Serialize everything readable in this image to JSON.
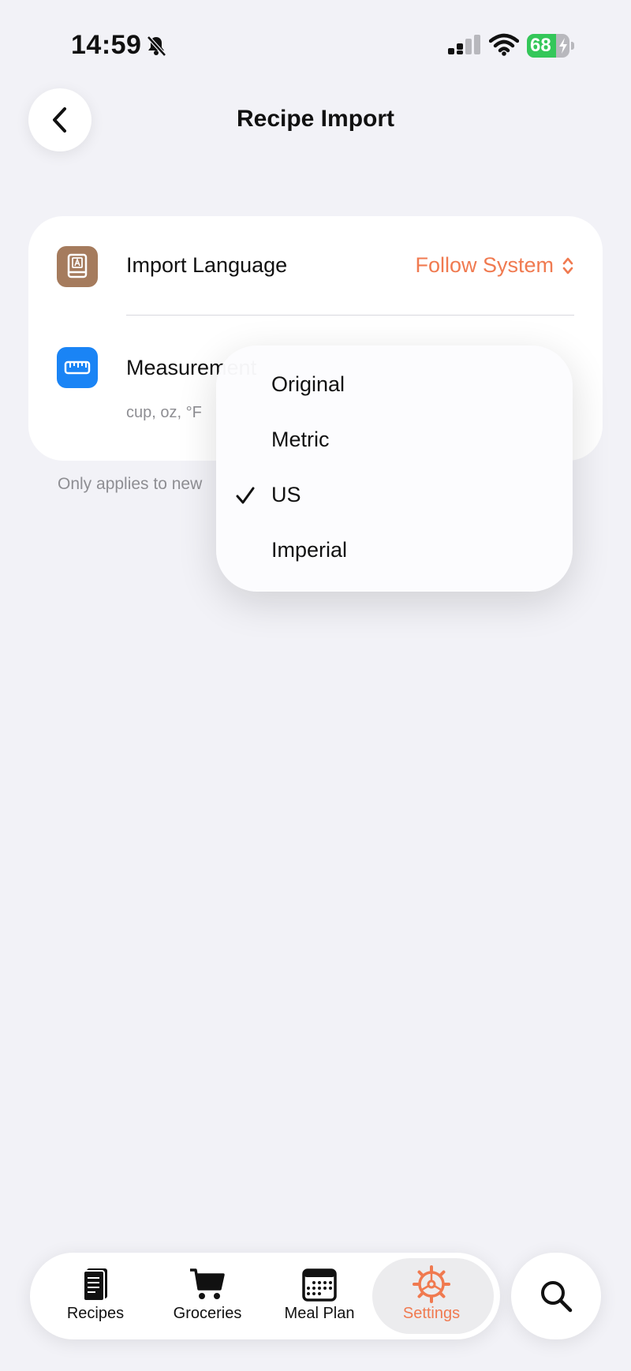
{
  "status_bar": {
    "time": "14:59",
    "battery": "68",
    "battery_level": 0.68
  },
  "header": {
    "title": "Recipe Import"
  },
  "settings": {
    "rows": [
      {
        "label": "Import Language",
        "value": "Follow System"
      },
      {
        "label": "Measurement",
        "subtitle": "cup, oz, °F"
      }
    ],
    "footnote": "Only applies to new"
  },
  "dropdown": {
    "options": [
      {
        "label": "Original",
        "selected": false
      },
      {
        "label": "Metric",
        "selected": false
      },
      {
        "label": "US",
        "selected": true
      },
      {
        "label": "Imperial",
        "selected": false
      }
    ]
  },
  "tab_bar": {
    "tabs": [
      {
        "label": "Recipes",
        "icon": "recipes-icon",
        "active": false
      },
      {
        "label": "Groceries",
        "icon": "cart-icon",
        "active": false
      },
      {
        "label": "Meal Plan",
        "icon": "calendar-icon",
        "active": false
      },
      {
        "label": "Settings",
        "icon": "gear-icon",
        "active": true
      }
    ]
  },
  "colors": {
    "accent": "#f07a50",
    "language_icon_bg": "#a57b5d",
    "measurement_icon_bg": "#1a84f5",
    "background": "#f2f2f7"
  }
}
